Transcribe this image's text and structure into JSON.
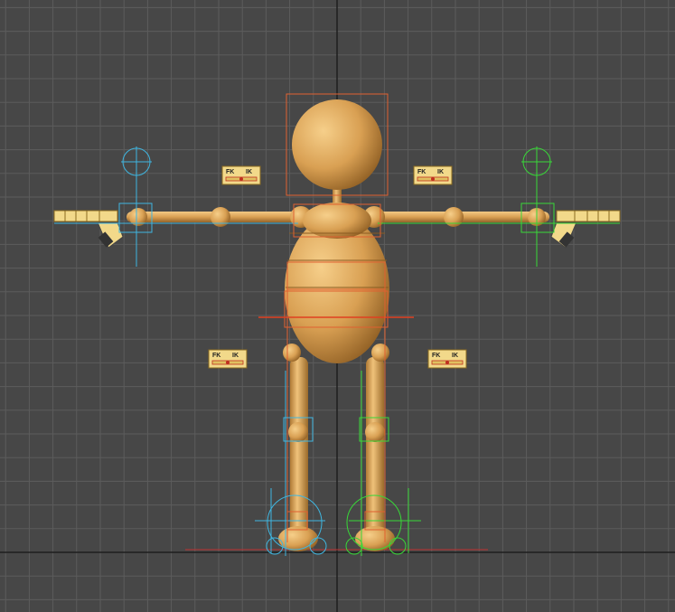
{
  "viewport": {
    "title": "",
    "background": "#474747",
    "grid_color": "#5c5c5c",
    "axis_dark_color": "#1e1e1e"
  },
  "character": {
    "skin_color": "#e0a85a",
    "skin_shadow": "#8a5a20"
  },
  "rig": {
    "right_color": "#3fb6e0",
    "left_color": "#38d838",
    "bounds_color": "#e06030",
    "center_color": "#e04020",
    "switch_fill": "#f2d98a"
  },
  "fkik_switches": [
    {
      "name": "arm-right",
      "fk": "FK",
      "ik": "IK"
    },
    {
      "name": "arm-left",
      "fk": "FK",
      "ik": "IK"
    },
    {
      "name": "leg-right",
      "fk": "FK",
      "ik": "IK"
    },
    {
      "name": "leg-left",
      "fk": "FK",
      "ik": "IK"
    }
  ]
}
